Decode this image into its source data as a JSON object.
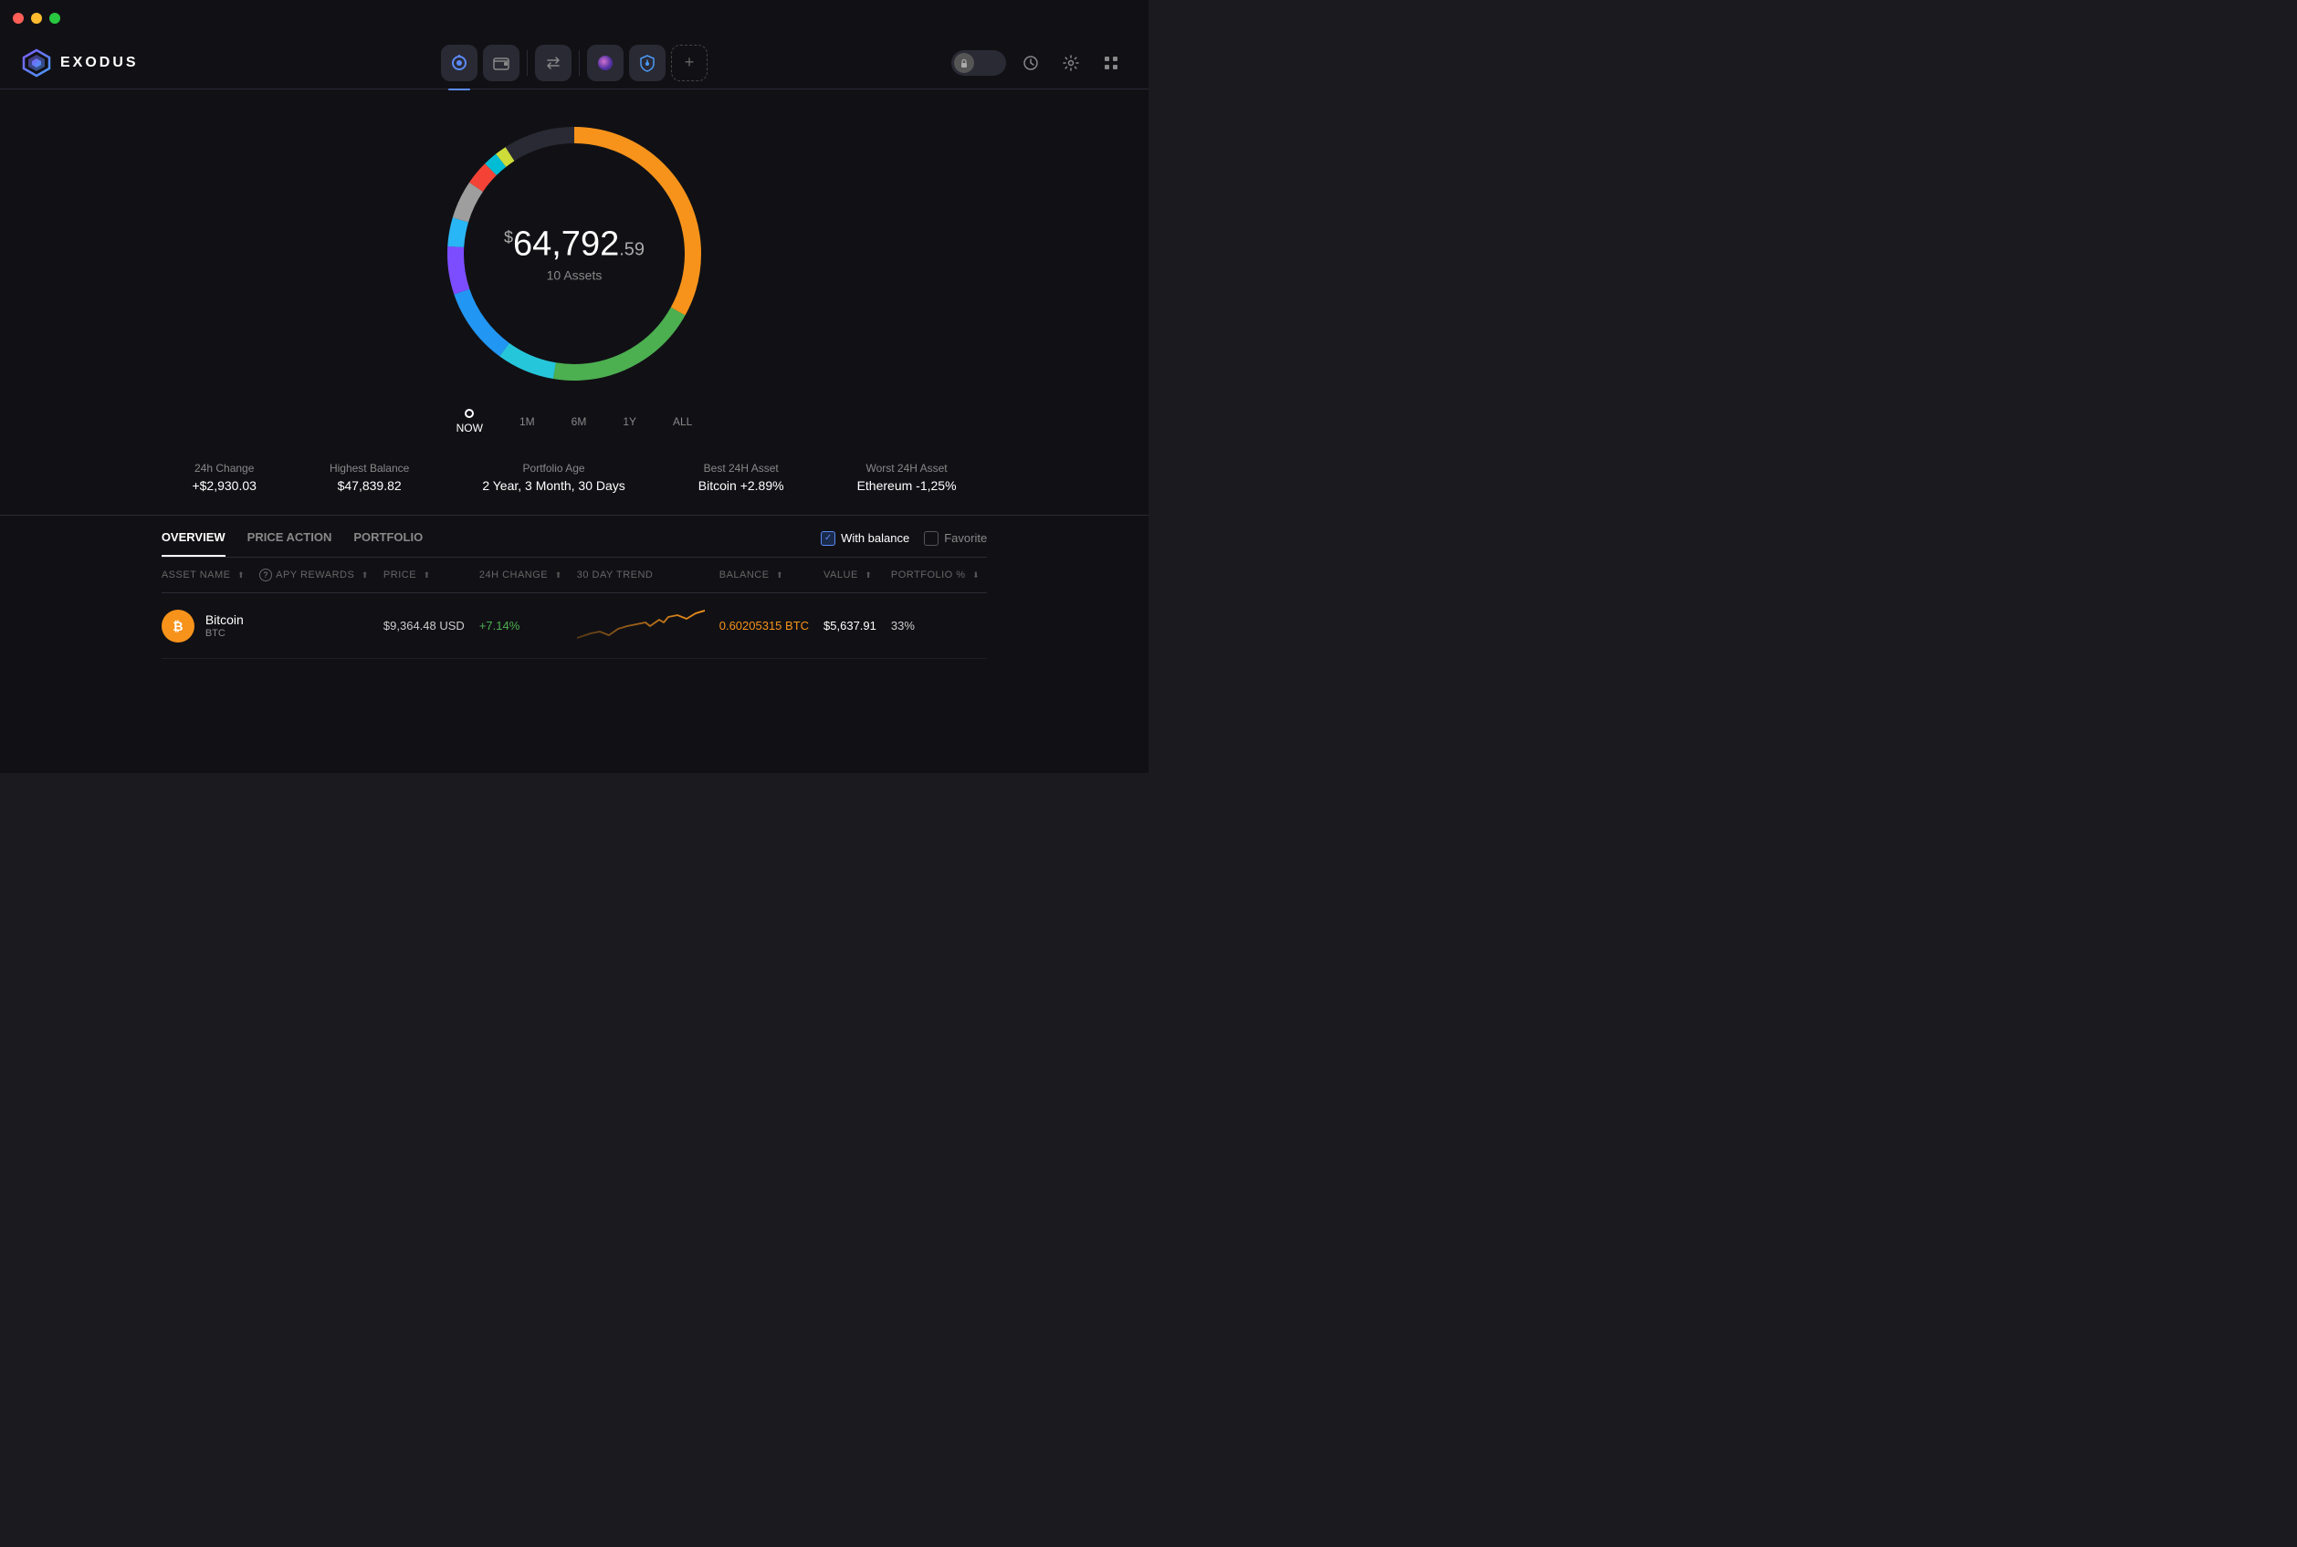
{
  "titlebar": {
    "lights": [
      "red",
      "yellow",
      "green"
    ]
  },
  "header": {
    "logo_text": "EXODUS",
    "nav_items": [
      {
        "id": "portfolio",
        "icon": "◎",
        "active": true
      },
      {
        "id": "wallet",
        "icon": "🟧",
        "active": false
      },
      {
        "id": "exchange",
        "icon": "⇄",
        "active": false
      },
      {
        "id": "nft",
        "icon": "🟣",
        "active": false
      },
      {
        "id": "shield",
        "icon": "🛡",
        "active": false
      },
      {
        "id": "add",
        "icon": "+",
        "active": false,
        "dashed": true
      }
    ],
    "right_buttons": [
      {
        "id": "lock",
        "type": "toggle"
      },
      {
        "id": "history",
        "icon": "🕐"
      },
      {
        "id": "settings",
        "icon": "⚙"
      },
      {
        "id": "grid",
        "icon": "⊞"
      }
    ]
  },
  "portfolio": {
    "amount_prefix": "$",
    "amount_main": "64,792",
    "amount_cents": ".59",
    "assets_label": "10 Assets"
  },
  "timeline": {
    "points": [
      "NOW",
      "1M",
      "6M",
      "1Y",
      "ALL"
    ],
    "active": "NOW"
  },
  "stats": [
    {
      "label": "24h Change",
      "value": "+$2,930.03"
    },
    {
      "label": "Highest Balance",
      "value": "$47,839.82"
    },
    {
      "label": "Portfolio Age",
      "value": "2 Year, 3 Month, 30 Days"
    },
    {
      "label": "Best 24H Asset",
      "value": "Bitcoin +2.89%"
    },
    {
      "label": "Worst 24H Asset",
      "value": "Ethereum -1,25%"
    }
  ],
  "tabs": {
    "items": [
      "OVERVIEW",
      "PRICE ACTION",
      "PORTFOLIO"
    ],
    "active": "OVERVIEW"
  },
  "filters": [
    {
      "id": "with_balance",
      "label": "With balance",
      "active": true
    },
    {
      "id": "favorite",
      "label": "Favorite",
      "active": false
    }
  ],
  "table": {
    "columns": [
      {
        "id": "asset_name",
        "label": "ASSET NAME",
        "sortable": true
      },
      {
        "id": "apy_rewards",
        "label": "APY REWARDS",
        "sortable": true,
        "has_help": true
      },
      {
        "id": "price",
        "label": "PRICE",
        "sortable": true
      },
      {
        "id": "change_24h",
        "label": "24H CHANGE",
        "sortable": true
      },
      {
        "id": "trend_30d",
        "label": "30 DAY TREND",
        "sortable": false
      },
      {
        "id": "balance",
        "label": "BALANCE",
        "sortable": true
      },
      {
        "id": "value",
        "label": "VALUE",
        "sortable": true
      },
      {
        "id": "portfolio_pct",
        "label": "PORTFOLIO %",
        "sortable": true
      }
    ],
    "rows": [
      {
        "name": "Bitcoin",
        "ticker": "BTC",
        "icon_bg": "#f7931a",
        "icon_letter": "₿",
        "apy_rewards": "",
        "price": "$9,364.48 USD",
        "change_24h": "+7.14%",
        "change_positive": true,
        "balance": "0.60205315 BTC",
        "balance_color": "#f7931a",
        "value": "$5,637.91",
        "portfolio_pct": "33%"
      }
    ]
  }
}
